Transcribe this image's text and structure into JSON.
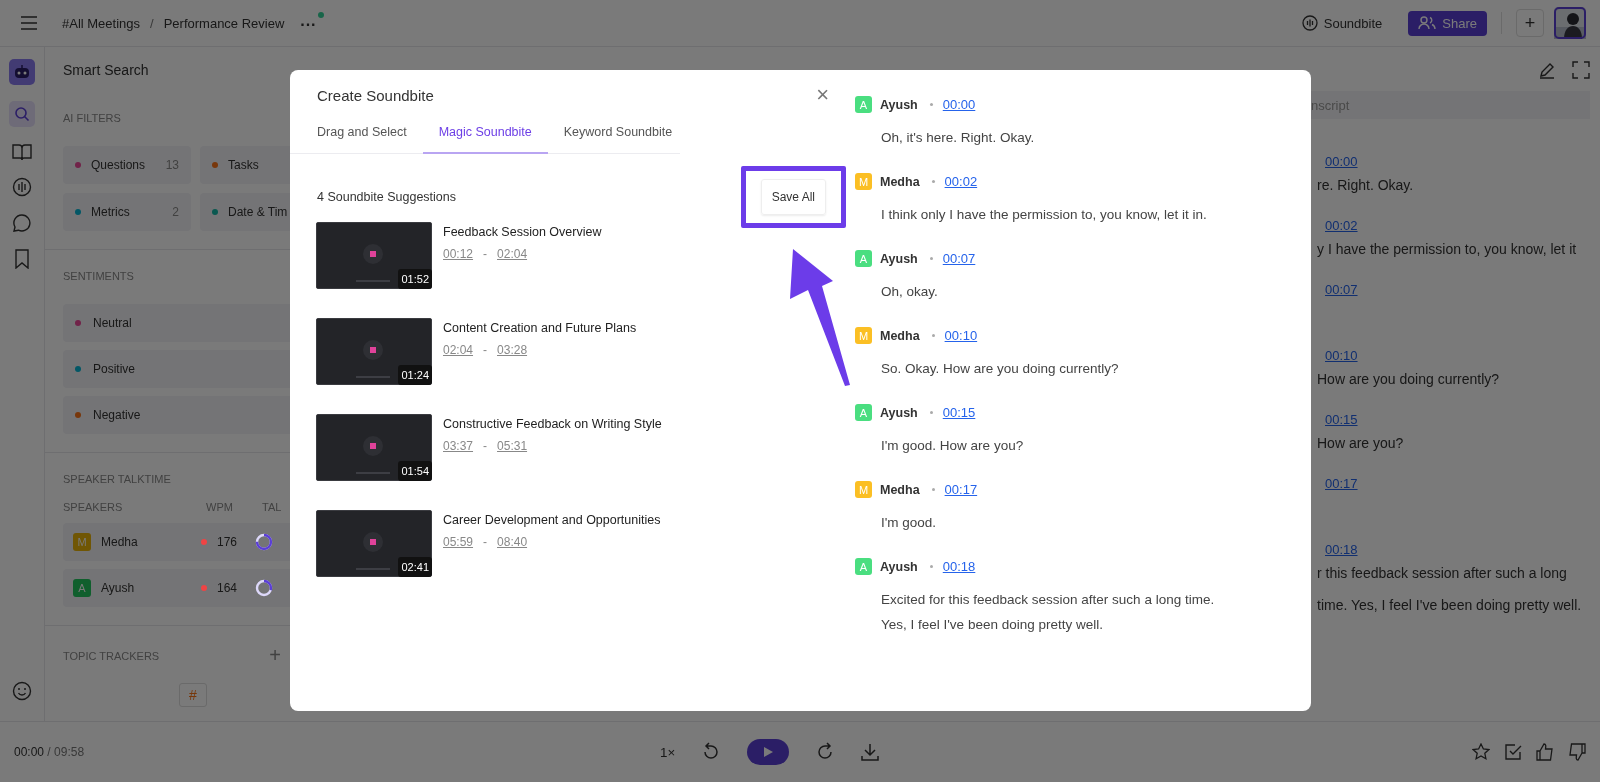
{
  "top_bar": {
    "breadcrumb": [
      "#All Meetings",
      "Performance Review"
    ],
    "separator": "/",
    "more": "···",
    "soundbite_button": "Soundbite",
    "share_button": "Share",
    "add_button": "+"
  },
  "smart_search": {
    "title": "Smart Search",
    "ai_filters": {
      "title": "AI FILTERS",
      "chips": [
        {
          "label": "Questions",
          "count": "13",
          "color": "#712349"
        },
        {
          "label": "Tasks",
          "color": "#78370b"
        },
        {
          "label": "Metrics",
          "count": "2",
          "color": "#035766"
        },
        {
          "label": "Date & Tim",
          "color": "#0a5850"
        }
      ]
    },
    "sentiments": {
      "title": "SENTIMENTS",
      "items": [
        {
          "label": "Neutral",
          "color": "#712349"
        },
        {
          "label": "Positive",
          "color": "#035766"
        },
        {
          "label": "Negative",
          "color": "#78370b"
        }
      ]
    },
    "talktime": {
      "title": "SPEAKER TALKTIME",
      "columns": [
        "SPEAKERS",
        "WPM",
        "TAL"
      ],
      "speakers": [
        {
          "initial": "M",
          "name": "Medha",
          "wpm": "176",
          "level": 0.75,
          "color": "#705604"
        },
        {
          "initial": "A",
          "name": "Ayush",
          "wpm": "164",
          "level": 0.3,
          "color": "#105f2d"
        }
      ]
    },
    "topic_trackers": {
      "title": "TOPIC TRACKERS",
      "add": "+",
      "tile": "#"
    }
  },
  "background_transcript": {
    "search_placeholder": "nscript",
    "entries": [
      {
        "time": "00:00",
        "text": "re. Right. Okay."
      },
      {
        "time": "00:02",
        "text": "y I have the permission to, you know, let it"
      },
      {
        "time": "00:07"
      },
      {
        "time": "00:10",
        "text": "How are you doing currently?"
      },
      {
        "time": "00:15",
        "text": "How are you?"
      },
      {
        "time": "00:17"
      },
      {
        "time": "00:18",
        "text": "r this feedback session after such a long"
      }
    ],
    "overflow_text": "time. Yes, I feel I've been doing pretty well."
  },
  "modal": {
    "title": "Create Soundbite",
    "close": "×",
    "tabs": [
      {
        "label": "Drag and Select",
        "selected": false
      },
      {
        "label": "Magic Soundbite",
        "selected": true
      },
      {
        "label": "Keyword Soundbite",
        "selected": false
      }
    ],
    "suggestions_title": "4 Soundbite Suggestions",
    "save_all": "Save All",
    "suggestions": [
      {
        "title": "Feedback Session Overview",
        "start": "00:12",
        "end": "02:04",
        "duration": "01:52"
      },
      {
        "title": "Content Creation and Future Plans",
        "start": "02:04",
        "end": "03:28",
        "duration": "01:24"
      },
      {
        "title": "Constructive Feedback on Writing Style",
        "start": "03:37",
        "end": "05:31",
        "duration": "01:54"
      },
      {
        "title": "Career Development and Opportunities",
        "start": "05:59",
        "end": "08:40",
        "duration": "02:41"
      }
    ],
    "range_separator": "-",
    "transcript": [
      {
        "initial": "A",
        "speaker": "Ayush",
        "color": "#4ade80",
        "time": "00:00",
        "text": "Oh, it's here. Right. Okay."
      },
      {
        "initial": "M",
        "speaker": "Medha",
        "color": "#fbbf24",
        "time": "00:02",
        "text": "I think only I have the permission to, you know, let it in."
      },
      {
        "initial": "A",
        "speaker": "Ayush",
        "color": "#4ade80",
        "time": "00:07",
        "text": "Oh, okay."
      },
      {
        "initial": "M",
        "speaker": "Medha",
        "color": "#fbbf24",
        "time": "00:10",
        "text": "So. Okay. How are you doing currently?"
      },
      {
        "initial": "A",
        "speaker": "Ayush",
        "color": "#4ade80",
        "time": "00:15",
        "text": "I'm good. How are you?"
      },
      {
        "initial": "M",
        "speaker": "Medha",
        "color": "#fbbf24",
        "time": "00:17",
        "text": "I'm good."
      },
      {
        "initial": "A",
        "speaker": "Ayush",
        "color": "#4ade80",
        "time": "00:18",
        "text": "Excited for this feedback session after such a long time. Yes, I feel I've been doing pretty well."
      }
    ]
  },
  "player": {
    "current": "00:00",
    "separator": "/",
    "total": "09:58",
    "speed": "1×"
  }
}
